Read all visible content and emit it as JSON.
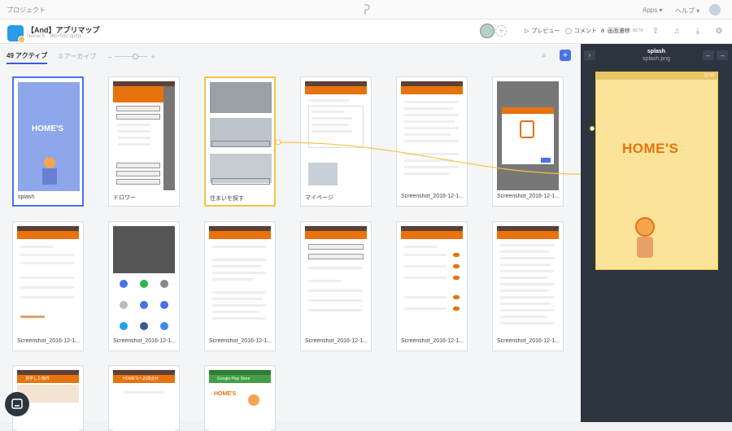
{
  "topbar": {
    "breadcrumb": "プロジェクト",
    "apps": "Apps ▾",
    "help": "ヘルプ ▾"
  },
  "app": {
    "title": "【And】アプリマップ",
    "subtitle": "Nexus 5 · 360×592 dp/dx"
  },
  "header_actions": {
    "preview": "プレビュー",
    "comment": "コメント",
    "flow": "画面遷移",
    "flow_badge": "BETA"
  },
  "tabs": {
    "active": "49 アクティブ",
    "archive": "0 アーカイブ"
  },
  "cards": [
    {
      "label": "splash",
      "state": "selected"
    },
    {
      "label": "ドロワー",
      "state": ""
    },
    {
      "label": "住まいを探す",
      "state": "linked"
    },
    {
      "label": "マイページ",
      "state": ""
    },
    {
      "label": "Screenshot_2016-12-1...",
      "state": ""
    },
    {
      "label": "Screenshot_2016-12-1...",
      "state": ""
    },
    {
      "label": "Screenshot_2016-12-1...",
      "state": ""
    },
    {
      "label": "Screenshot_2016-12-1...",
      "state": ""
    },
    {
      "label": "Screenshot_2016-12-1...",
      "state": ""
    },
    {
      "label": "Screenshot_2016-12-1...",
      "state": ""
    },
    {
      "label": "Screenshot_2016-12-1...",
      "state": ""
    },
    {
      "label": "Screenshot_2016-12-1...",
      "state": ""
    }
  ],
  "bottom_cards": [
    {
      "title": "見学した物件"
    },
    {
      "title": "HOME'Sへお問合せ"
    },
    {
      "title": "Google Play Store"
    }
  ],
  "preview": {
    "title": "splash",
    "file": "splash.png",
    "brand": "HOME'S",
    "time": "12:30"
  },
  "colors": {
    "accent": "#4a72e8",
    "orange": "#e8720c",
    "link": "#f6c445",
    "dark": "#2c3440"
  }
}
